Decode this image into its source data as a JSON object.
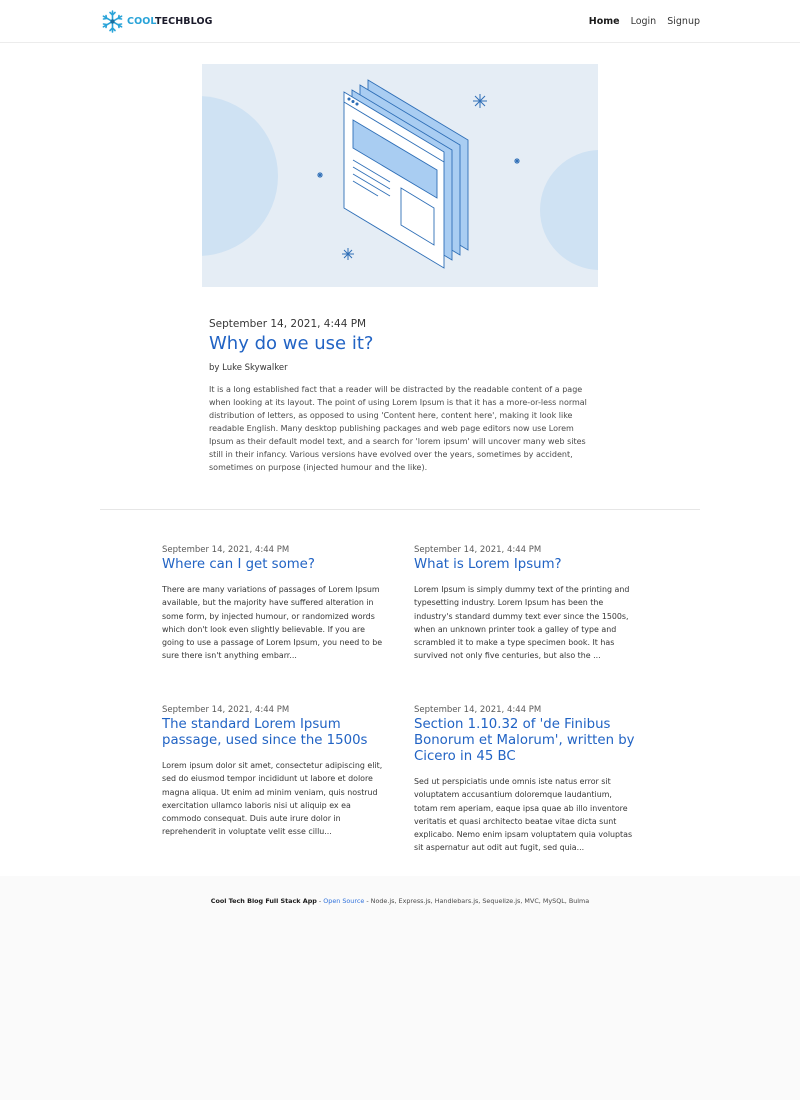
{
  "navbar": {
    "logo_part1": "COOL",
    "logo_part2": "TECHBLOG",
    "links": [
      {
        "label": "Home"
      },
      {
        "label": "Login"
      },
      {
        "label": "Signup"
      }
    ]
  },
  "featured": {
    "date": "September 14, 2021, 4:44 PM",
    "title": "Why do we use it?",
    "author": "by Luke Skywalker",
    "body": "It is a long established fact that a reader will be distracted by the readable content of a page when looking at its layout. The point of using Lorem Ipsum is that it has a more-or-less normal distribution of letters, as opposed to using 'Content here, content here', making it look like readable English. Many desktop publishing packages and web page editors now use Lorem Ipsum as their default model text, and a search for 'lorem ipsum' will uncover many web sites still in their infancy. Various versions have evolved over the years, sometimes by accident, sometimes on purpose (injected humour and the like)."
  },
  "posts": [
    {
      "date": "September 14, 2021, 4:44 PM",
      "title": "Where can I get some?",
      "excerpt": "There are many variations of passages of Lorem Ipsum available, but the majority have suffered alteration in some form, by injected humour, or randomized words which don't look even slightly believable. If you are going to use a passage of Lorem Ipsum, you need to be sure there isn't anything embarr..."
    },
    {
      "date": "September 14, 2021, 4:44 PM",
      "title": "What is Lorem Ipsum?",
      "excerpt": "Lorem Ipsum is simply dummy text of the printing and typesetting industry. Lorem Ipsum has been the industry's standard dummy text ever since the 1500s, when an unknown printer took a galley of type and scrambled it to make a type specimen book. It has survived not only five centuries, but also the ..."
    },
    {
      "date": "September 14, 2021, 4:44 PM",
      "title": "The standard Lorem Ipsum passage, used since the 1500s",
      "excerpt": "Lorem ipsum dolor sit amet, consectetur adipiscing elit, sed do eiusmod tempor incididunt ut labore et dolore magna aliqua. Ut enim ad minim veniam, quis nostrud exercitation ullamco laboris nisi ut aliquip ex ea commodo consequat. Duis aute irure dolor in reprehenderit in voluptate velit esse cillu..."
    },
    {
      "date": "September 14, 2021, 4:44 PM",
      "title": "Section 1.10.32 of 'de Finibus Bonorum et Malorum', written by Cicero in 45 BC",
      "excerpt": "Sed ut perspiciatis unde omnis iste natus error sit voluptatem accusantium doloremque laudantium, totam rem aperiam, eaque ipsa quae ab illo inventore veritatis et quasi architecto beatae vitae dicta sunt explicabo. Nemo enim ipsam voluptatem quia voluptas sit aspernatur aut odit aut fugit, sed quia..."
    }
  ],
  "footer": {
    "brand": "Cool Tech Blog Full Stack App",
    "sep1": " - ",
    "link": "Open Source",
    "sep2": " - ",
    "tech": "Node.js, Express.js, Handlebars.js, Sequelize.js, MVC, MySQL, Bulma"
  },
  "colors": {
    "accent": "#2163c4",
    "logo_blue": "#29a3d8",
    "hero_bg": "#e5edf5",
    "hero_circle": "#cfe2f3",
    "link": "#3273dc"
  },
  "icons": {
    "logo": "snowflake-icon",
    "hero": "browser-window-illustration"
  }
}
